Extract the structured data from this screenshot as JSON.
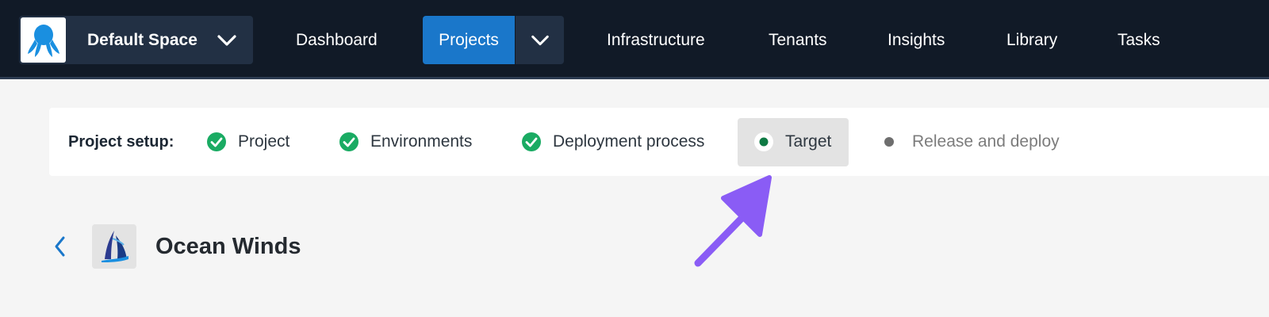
{
  "nav": {
    "space_name": "Default Space",
    "items": [
      "Dashboard",
      "Projects",
      "Infrastructure",
      "Tenants",
      "Insights",
      "Library",
      "Tasks"
    ],
    "active": "Projects"
  },
  "setup": {
    "label": "Project setup:",
    "steps": [
      {
        "label": "Project",
        "status": "complete"
      },
      {
        "label": "Environments",
        "status": "complete"
      },
      {
        "label": "Deployment process",
        "status": "complete"
      },
      {
        "label": "Target",
        "status": "current"
      },
      {
        "label": "Release and deploy",
        "status": "pending"
      }
    ]
  },
  "project": {
    "name": "Ocean Winds"
  },
  "colors": {
    "nav_bg": "#111a27",
    "active_blue": "#1a77ca",
    "check_green": "#1aab63",
    "annotation_purple": "#8a5cf5"
  }
}
